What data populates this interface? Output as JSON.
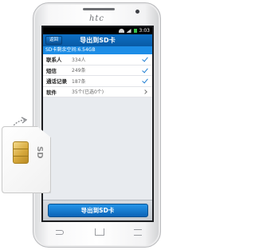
{
  "phone": {
    "brand": "htc"
  },
  "status_bar": {
    "time": "3:03"
  },
  "header": {
    "back_label": "返回",
    "title": "导出到SD卡"
  },
  "storage": {
    "label": "SD卡剩余空间:6.54GB"
  },
  "rows": [
    {
      "label": "联系人",
      "count": "334人",
      "control": "check"
    },
    {
      "label": "短信",
      "count": "249条",
      "control": "check"
    },
    {
      "label": "通话记录",
      "count": "187条",
      "control": "check"
    },
    {
      "label": "软件",
      "count": "35个(已选0个)",
      "control": "chevron"
    }
  ],
  "bottom": {
    "export_label": "导出到SD卡"
  },
  "sdcard": {
    "label": "SD"
  },
  "colors": {
    "accent": "#0b63b7",
    "header": "#0e6fc4",
    "chip": "#d7a93c"
  }
}
